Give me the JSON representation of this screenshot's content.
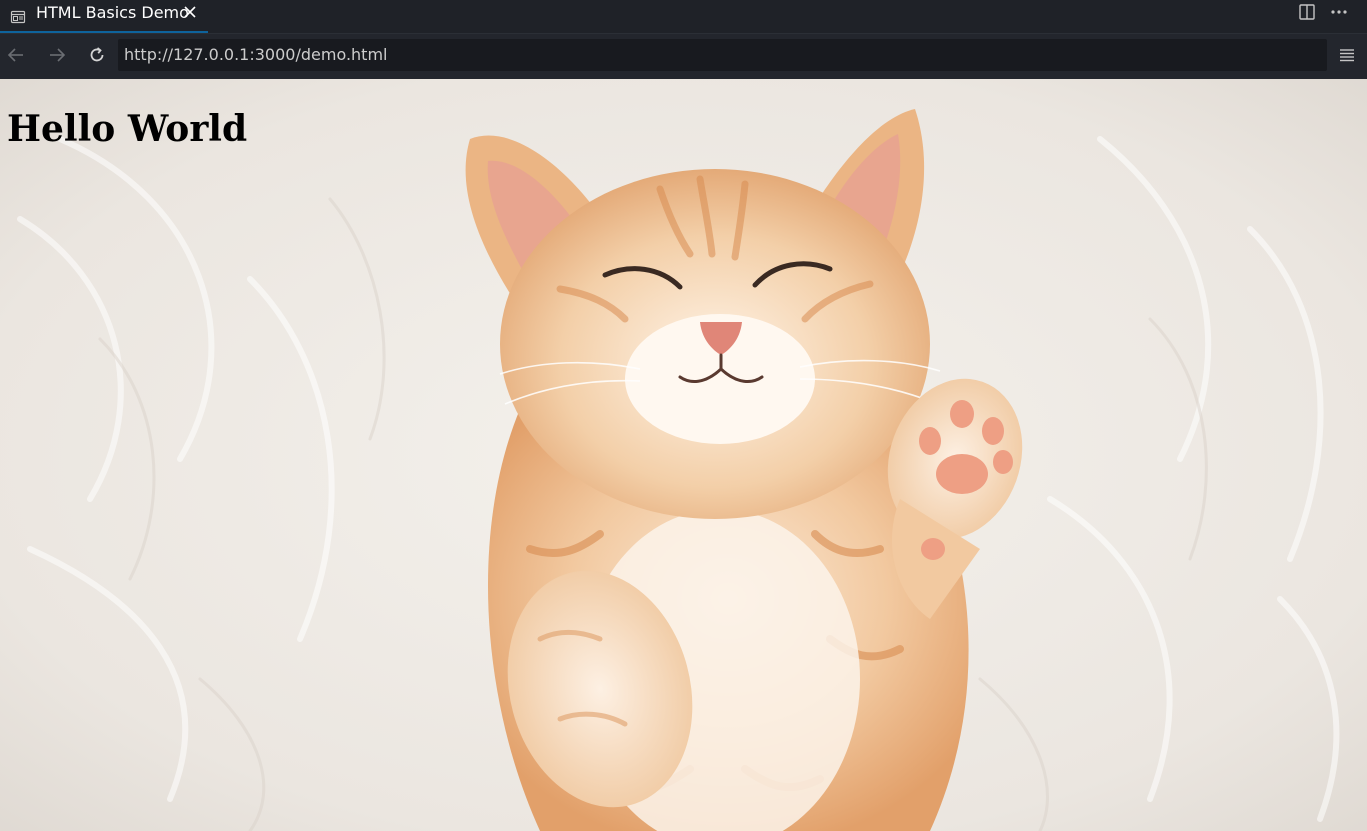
{
  "tab": {
    "title": "HTML Basics Demo",
    "icon": "preview-icon",
    "close_icon": "close-icon"
  },
  "toolbar": {
    "actions": [
      "split-editor-icon",
      "more-actions-icon"
    ]
  },
  "nav": {
    "back_icon": "arrow-left-icon",
    "forward_icon": "arrow-right-icon",
    "reload_icon": "reload-icon",
    "url": "http://127.0.0.1:3000/demo.html",
    "menu_icon": "hamburger-menu-icon"
  },
  "page": {
    "heading": "Hello World",
    "image_subject": "kitten"
  },
  "colors": {
    "chrome_bg": "#1f2228",
    "nav_bg": "#23262d",
    "url_bg": "#181a1f",
    "tab_accent": "#0e639c",
    "heading_color": "#000000"
  }
}
